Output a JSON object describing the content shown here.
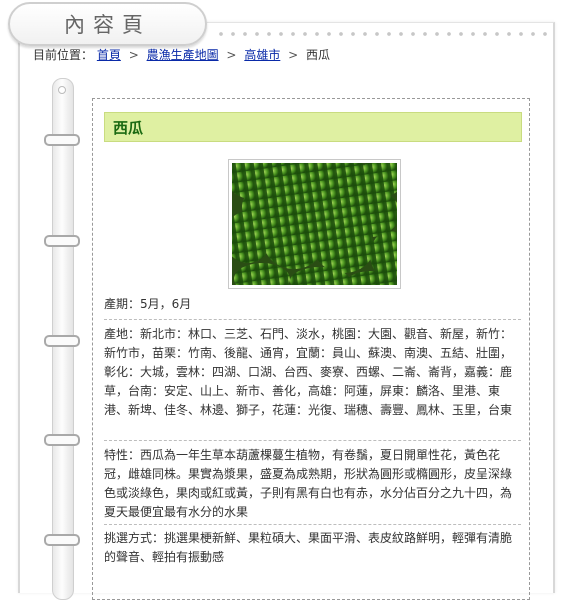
{
  "header": {
    "tab_label": "內容頁"
  },
  "breadcrumb": {
    "prefix": "目前位置：",
    "items": [
      "首頁",
      "農漁生產地圖",
      "高雄市"
    ],
    "current": "西瓜",
    "separator": ">"
  },
  "product": {
    "title": "西瓜",
    "image_alt": "西瓜",
    "season": "產期：5月，6月",
    "origin": "產地：新北市：林口、三芝、石門、淡水，桃園：大園、觀音、新屋，新竹：新竹市，苗栗：竹南、後龍、通宵，宜蘭：員山、蘇澳、南澳、五結、壯圍，彰化：大城，雲林：四湖、口湖、台西、麥寮、西螺、二崙、崙背，嘉義：鹿草，台南：安定、山上、新市、善化，高雄：阿蓮，屏東：麟洛、里港、東港、新埤、佳冬、林邊、獅子，花蓮：光復、瑞穗、壽豐、鳳林、玉里，台東",
    "characteristics": "特性：西瓜為一年生草本葫蘆棵蔓生植物，有卷鬚，夏日開單性花，黃色花冠，雌雄同株。果實為漿果，盛夏為成熟期，形狀為圓形或橢圓形，皮呈深綠色或淡綠色，果肉或紅或黃，子則有黑有白也有赤，水分佔百分之九十四，為夏天最便宜最有水分的水果",
    "selection_tips": "挑選方式：挑選果梗新鮮、果粒碩大、果面平滑、表皮紋路鮮明，輕彈有清脆的聲音、輕拍有振動感"
  },
  "colors": {
    "title_bg": "#dff0a2",
    "title_text": "#1b6a12",
    "link": "#0a2aa8"
  }
}
